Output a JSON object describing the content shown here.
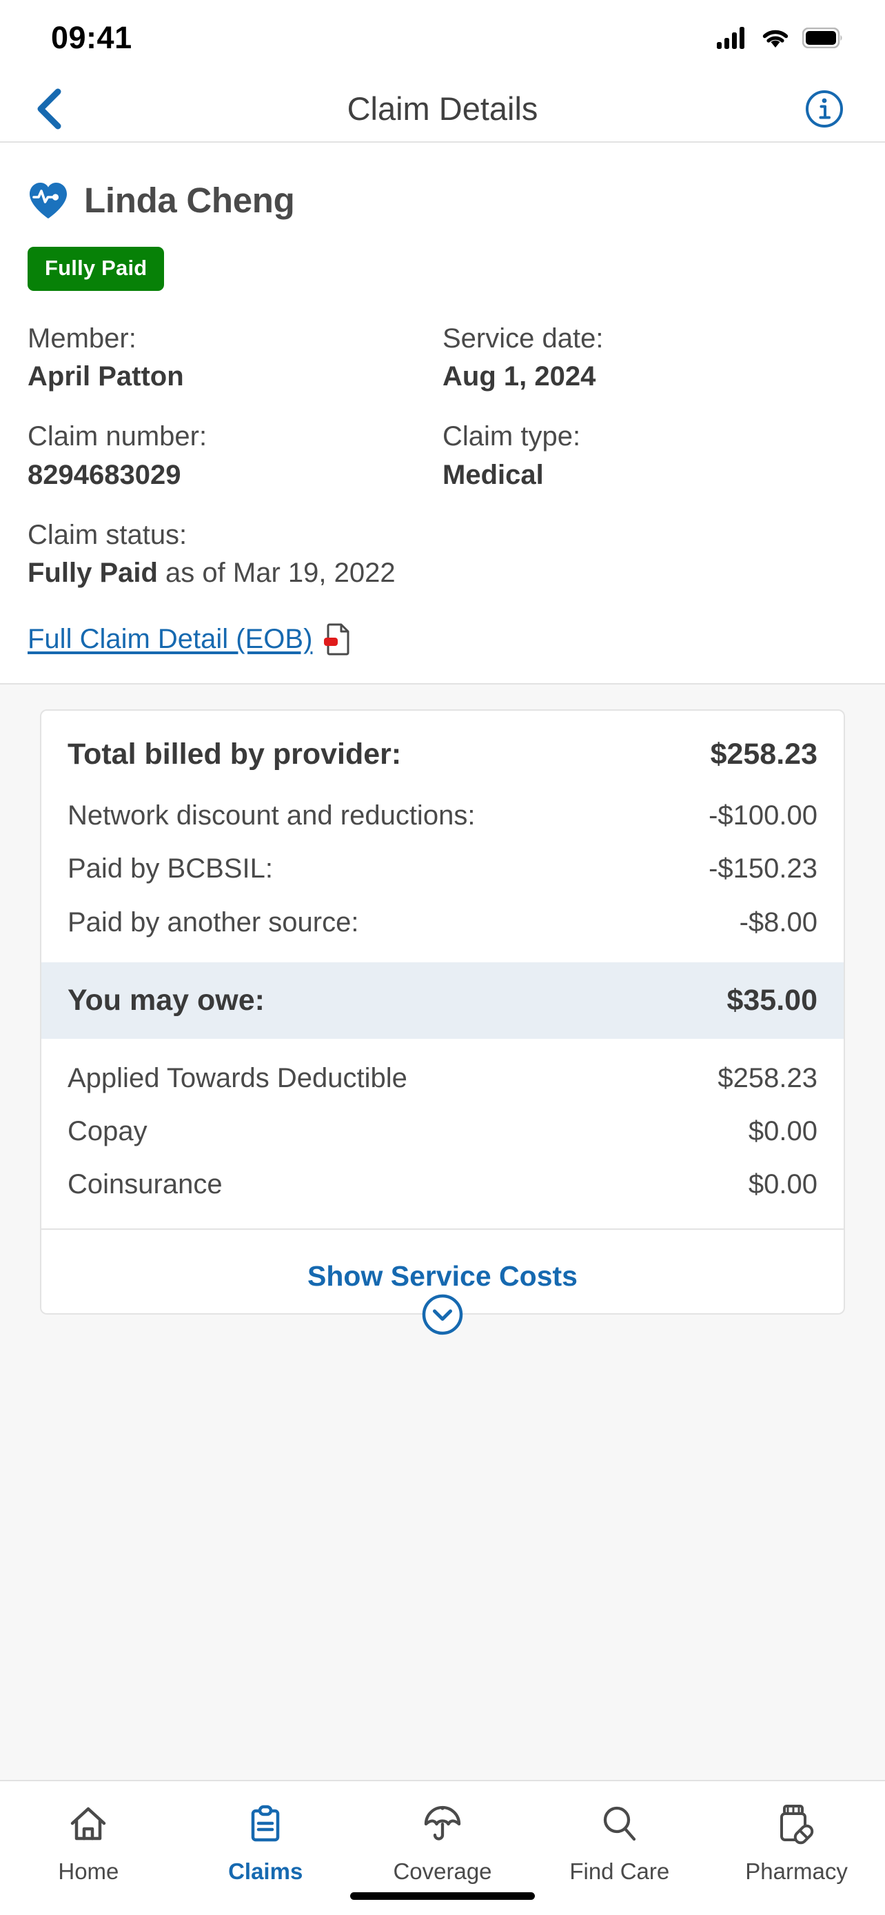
{
  "status_bar": {
    "time": "09:41",
    "cellular_icon": "cellular-signal-icon",
    "wifi_icon": "wifi-icon",
    "battery_icon": "battery-icon"
  },
  "nav": {
    "back_icon": "chevron-left-icon",
    "title": "Claim Details",
    "info_icon": "info-circle-icon"
  },
  "claim": {
    "plan_icon": "heart-pulse-icon",
    "plan_name": "Linda Cheng",
    "status_badge": "Fully Paid",
    "fields": [
      {
        "label": "Member:",
        "value": "April Patton"
      },
      {
        "label": "Service date:",
        "value": "Aug 1, 2024"
      },
      {
        "label": "Claim number:",
        "value": "8294683029"
      },
      {
        "label": "Claim type:",
        "value": "Medical"
      }
    ],
    "status_label": "Claim status:",
    "status_value": "Fully Paid",
    "status_suffix": " as of Mar 19, 2022",
    "eob_link": "Full Claim Detail (EOB)",
    "eob_icon": "pdf-document-icon"
  },
  "costs": {
    "total_label": "Total billed by provider:",
    "total_amount": "$258.23",
    "lines": [
      {
        "label": "Network discount and reductions:",
        "amount": "-$100.00"
      },
      {
        "label": "Paid by BCBSIL:",
        "amount": "-$150.23"
      },
      {
        "label": "Paid by another source:",
        "amount": "-$8.00"
      }
    ],
    "owe_label": "You may owe:",
    "owe_amount": "$35.00",
    "breakdown": [
      {
        "label": "Applied Towards Deductible",
        "amount": "$258.23"
      },
      {
        "label": "Copay",
        "amount": "$0.00"
      },
      {
        "label": "Coinsurance",
        "amount": "$0.00"
      }
    ],
    "expand_label": "Show Service Costs",
    "expand_icon": "chevron-down-circle-icon"
  },
  "tabbar": {
    "items": [
      {
        "label": "Home",
        "icon": "home-icon",
        "active": false
      },
      {
        "label": "Claims",
        "icon": "clipboard-icon",
        "active": true
      },
      {
        "label": "Coverage",
        "icon": "umbrella-icon",
        "active": false
      },
      {
        "label": "Find Care",
        "icon": "search-icon",
        "active": false
      },
      {
        "label": "Pharmacy",
        "icon": "pill-bottle-icon",
        "active": false
      }
    ]
  },
  "colors": {
    "accent_blue": "#1669b0",
    "paid_green": "#078107",
    "owe_highlight": "#e8eef4",
    "section_bg": "#f7f7f7",
    "text": "#4a4a4a"
  }
}
